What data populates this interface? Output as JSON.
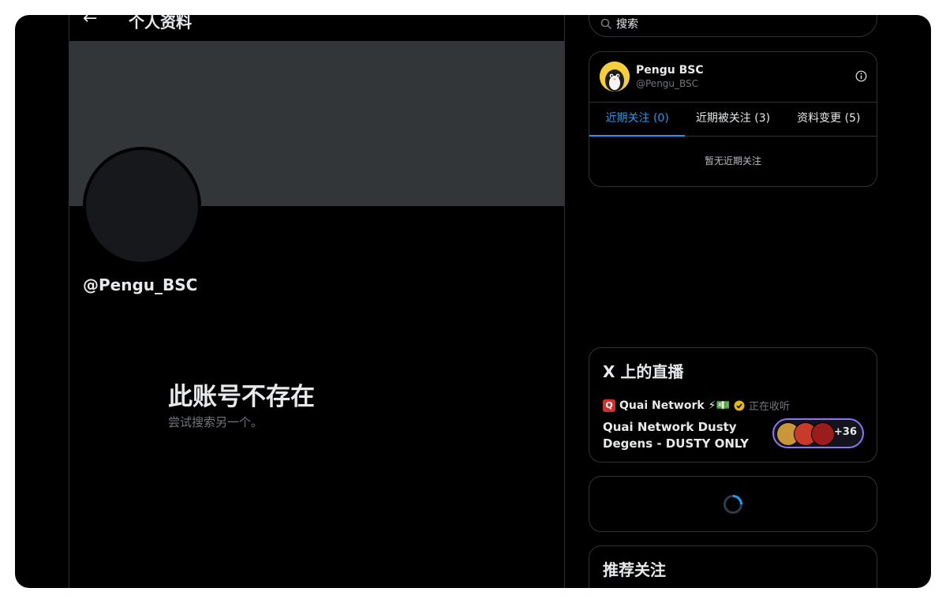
{
  "header": {
    "title": "个人资料",
    "back_icon": "arrow-left-icon"
  },
  "profile": {
    "handle": "@Pengu_BSC",
    "empty_title": "此账号不存在",
    "empty_subtitle": "尝试搜索另一个。"
  },
  "search": {
    "placeholder": "搜索",
    "icon": "search-icon"
  },
  "user_card": {
    "name": "Pengu BSC",
    "handle": "@Pengu_BSC",
    "tabs": [
      {
        "label": "近期关注 (0)",
        "active": true
      },
      {
        "label": "近期被关注 (3)",
        "active": false
      },
      {
        "label": "资料变更 (5)",
        "active": false
      }
    ],
    "empty_text": "暂无近期关注"
  },
  "live": {
    "title": "X 上的直播",
    "host_name": "Quai Network",
    "host_emojis": "⚡💵",
    "listening_label": "正在收听",
    "space_title": "Quai Network Dusty Degens - DUSTY ONLY",
    "listener_count": "+36"
  },
  "recommend": {
    "title": "推荐关注"
  },
  "colors": {
    "accent": "#1d9bf0",
    "banner": "#333639",
    "border": "#2f3336",
    "listeners_border": "#8d74f7"
  }
}
